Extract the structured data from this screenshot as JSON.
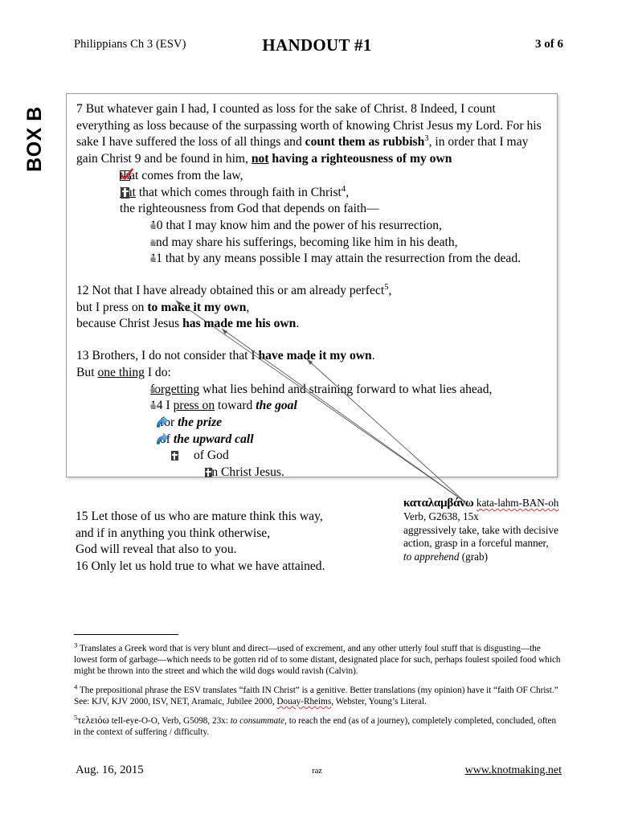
{
  "header": {
    "left": "Philippians Ch 3 (ESV)",
    "title": "HANDOUT #1",
    "page": "3 of 6"
  },
  "box_label": "BOX B",
  "scripture": {
    "v7_8_9": {
      "line1_a": "7 But whatever gain I had, I counted as loss for the sake of Christ. 8 Indeed, I count everything as loss because of the surpassing worth of knowing Christ Jesus my Lord. For his sake I have suffered the loss of all things and ",
      "bold_rubbish": "count them as rubbish",
      "rubbish_ref": "3",
      "line1_b": ", in order that I may gain Christ 9 and be found in him, ",
      "bold_not": "not",
      "bold_having": " having a righteousness of my own"
    },
    "sub_law": "that comes from the law,",
    "sub_but": "but",
    "sub_faith": " that which comes through faith in Christ",
    "faith_ref": "4",
    "sub_faith_end": ",",
    "sub_righteousness": "the righteousness from God that depends on faith—",
    "bullets_10_11": [
      "10 that I may know him and the power of his resurrection,",
      "and may share his sufferings, becoming like him in his death,",
      "11 that by any means possible I may attain the resurrection from the dead."
    ],
    "v12": {
      "line1": "12 Not that I have already obtained this or am already perfect",
      "line1_ref": "5",
      "line1_end": ",",
      "line2_a": "but I press on ",
      "line2_b": "to make it my own",
      "line2_c": ",",
      "line3_a": "because Christ Jesus ",
      "line3_b": "has made me his own",
      "line3_c": "."
    },
    "v13": {
      "line1_a": "13 Brothers, I do not consider that I ",
      "line1_b": "have made it my own",
      "line1_c": ".",
      "line2_a": "But ",
      "line2_b": "one thing",
      "line2_c": " I do:"
    },
    "v13_bullet": {
      "u": "forgetting",
      "rest": " what lies behind and straining forward to what lies ahead,"
    },
    "v14": {
      "pre": "14 I ",
      "u": "press on",
      "mid": " toward ",
      "goal": "the goal"
    },
    "prize": {
      "pre": "for ",
      "em": "the prize"
    },
    "upward": {
      "pre": "of ",
      "em": "the upward call"
    },
    "of_god": "of God",
    "in_christ": "in Christ Jesus."
  },
  "annotation": {
    "greek": "καταλαμβάνω",
    "pronunciation": "kata-lahm-BAN-oh",
    "grammar": "Verb, G2638, 15x",
    "gloss_line1": "aggressively take, take with decisive",
    "gloss_line2": "action, grasp in a forceful manner,",
    "gloss_italic": "to apprehend",
    "gloss_tail": " (grab)"
  },
  "closing": [
    "15 Let those of us who are mature think this way,",
    "and if in anything you think otherwise,",
    "God will reveal that also to you.",
    "16 Only let us hold true to what we have attained."
  ],
  "footnotes": {
    "fn3": {
      "marker": "3",
      "text": " Translates a Greek word that is very blunt and direct—used of excrement, and any other utterly foul stuff that is disgusting—the lowest form of garbage—which needs to be gotten rid of to some distant, designated place for such, perhaps foulest spoiled food which might be thrown into the street and which the wild dogs would ravish (Calvin)."
    },
    "fn4": {
      "marker": "4",
      "text_a": " The prepositional phrase the ESV translates “faith IN Christ” is a genitive.  Better translations (my opinion) have it “faith OF Christ.”  See:  KJV, KJV 2000, ISV, NET, Aramaic, Jubilee 2000, ",
      "spell": "Douay-Rheims",
      "text_b": ", Webster, Young’s Literal."
    },
    "fn5": {
      "marker": "5",
      "greek": "τελειόω",
      "text_a": "  tell-eye-O-O, Verb, G5098, 23x:  ",
      "italic": "to consummate",
      "text_b": ", to reach the end (as of a journey), completely completed, concluded, often in the context of suffering / difficulty."
    }
  },
  "footer": {
    "date": "Aug. 16,  2015",
    "initials": "raz",
    "url": "www.knotmaking.net"
  },
  "colors": {
    "check_mark": "#d81f1f",
    "spell_underline": "#e03030",
    "bullet_dot": "#8d8d8d",
    "arrow_blue": "#2f86d8",
    "box_border": "#9a9a9a",
    "leader_line": "#555555"
  }
}
